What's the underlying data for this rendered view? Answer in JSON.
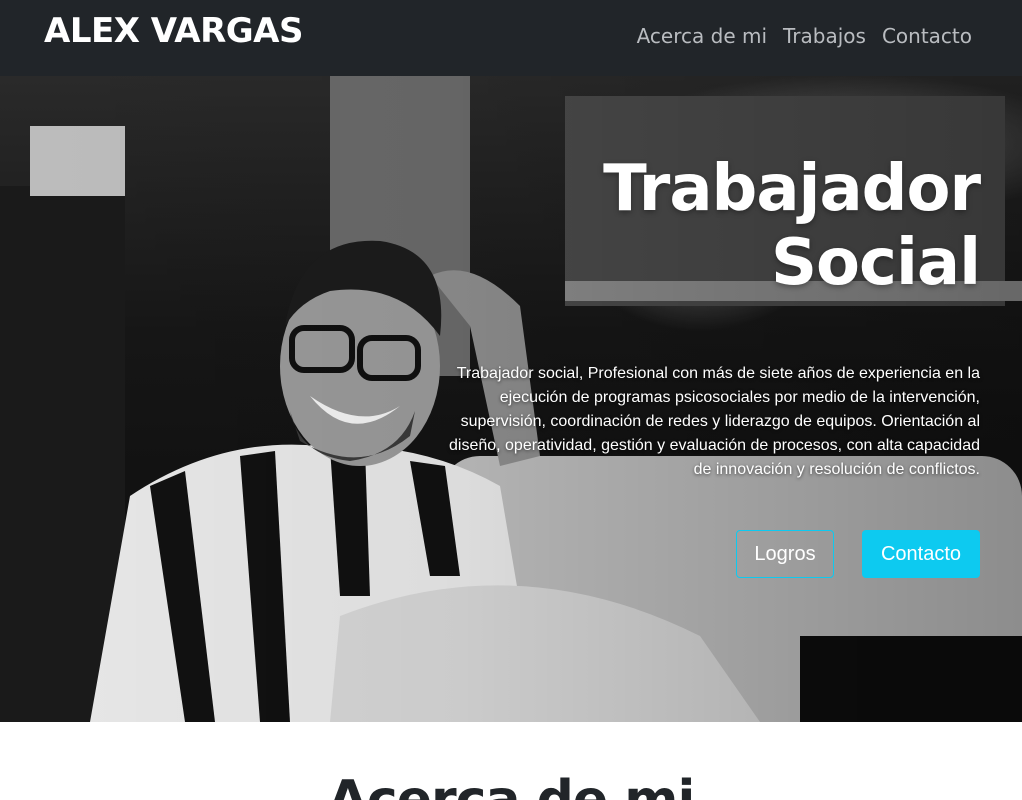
{
  "navbar": {
    "brand": "ALEX VARGAS",
    "links": [
      "Acerca de mi",
      "Trabajos",
      "Contacto"
    ]
  },
  "hero": {
    "title_line1": "Trabajador",
    "title_line2": "Social",
    "description": "Trabajador social, Profesional con más de siete años de experiencia en la ejecución de programas psicosociales por medio de la intervención, supervisión, coordinación de redes y liderazgo de equipos. Orientación al diseño, operatividad, gestión y evaluación de procesos, con alta capacidad de innovación y resolución de conflictos.",
    "button_outline": "Logros",
    "button_primary": "Contacto"
  },
  "about": {
    "title": "Acerca de mi"
  },
  "colors": {
    "navbar_bg": "#212529",
    "accent": "#0dcaf0",
    "nav_link": "#b9bcc0"
  }
}
